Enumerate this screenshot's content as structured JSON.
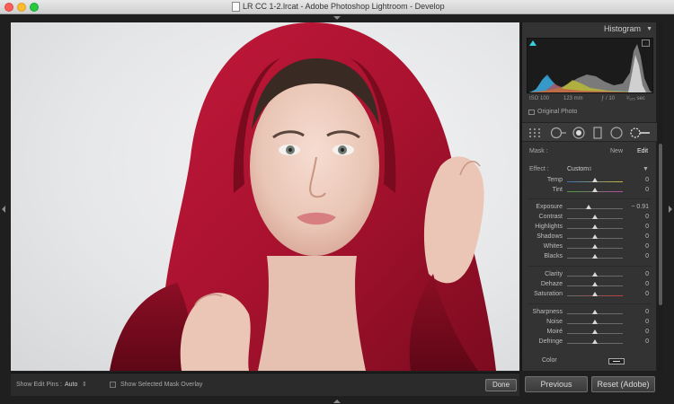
{
  "window": {
    "title": "LR CC 1-2.lrcat - Adobe Photoshop Lightroom - Develop"
  },
  "toolbar": {
    "pins_label": "Show Edit Pins :",
    "pins_value": "Auto",
    "overlay_label": "Show Selected Mask Overlay",
    "done_label": "Done"
  },
  "histogram": {
    "title": "Histogram",
    "iso": "ISO 100",
    "focal": "123 mm",
    "aperture": "ƒ / 10",
    "shutter": "¹⁄₁₂₅ sec",
    "original_photo_label": "Original Photo"
  },
  "mask": {
    "label": "Mask :",
    "new_label": "New",
    "edit_label": "Edit"
  },
  "effect": {
    "label": "Effect :",
    "value": "Custom"
  },
  "sliders": [
    {
      "label": "Temp",
      "value": "0",
      "pos": 0.5
    },
    {
      "label": "Tint",
      "value": "0",
      "pos": 0.5
    },
    {
      "label": "Exposure",
      "value": "− 0.91",
      "pos": 0.38
    },
    {
      "label": "Contrast",
      "value": "0",
      "pos": 0.5
    },
    {
      "label": "Highlights",
      "value": "0",
      "pos": 0.5
    },
    {
      "label": "Shadows",
      "value": "0",
      "pos": 0.5
    },
    {
      "label": "Whites",
      "value": "0",
      "pos": 0.5
    },
    {
      "label": "Blacks",
      "value": "0",
      "pos": 0.5
    },
    {
      "label": "Clarity",
      "value": "0",
      "pos": 0.5
    },
    {
      "label": "Dehaze",
      "value": "0",
      "pos": 0.5
    },
    {
      "label": "Saturation",
      "value": "0",
      "pos": 0.5
    },
    {
      "label": "Sharpness",
      "value": "0",
      "pos": 0.5
    },
    {
      "label": "Noise",
      "value": "0",
      "pos": 0.5
    },
    {
      "label": "Moiré",
      "value": "0",
      "pos": 0.5
    },
    {
      "label": "Defringe",
      "value": "0",
      "pos": 0.5
    }
  ],
  "color": {
    "label": "Color"
  },
  "buttons": {
    "previous_label": "Previous",
    "reset_label": "Reset (Adobe)"
  },
  "colors": {
    "hood_red": "#a8122e",
    "panel_bg": "#333333",
    "app_bg": "#1f1f1f",
    "clip_indicator": "#35d0e0"
  }
}
